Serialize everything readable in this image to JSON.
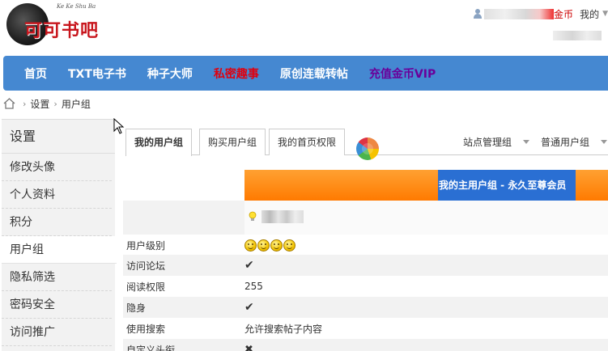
{
  "header": {
    "logo_text": "可可书吧",
    "logo_subtext": "Ke Ke Shu Ba",
    "coin_label": "金币",
    "my_label": "我的"
  },
  "nav": {
    "items": [
      {
        "label": "首页",
        "style": "normal"
      },
      {
        "label": "TXT电子书",
        "style": "normal"
      },
      {
        "label": "种子大师",
        "style": "normal"
      },
      {
        "label": "私密趣事",
        "style": "red"
      },
      {
        "label": "原创连载转帖",
        "style": "normal"
      },
      {
        "label": "充值金币VIP",
        "style": "purple"
      }
    ]
  },
  "breadcrumb": {
    "items": [
      "设置",
      "用户组"
    ]
  },
  "sidebar": {
    "title": "设置",
    "items": [
      {
        "label": "修改头像"
      },
      {
        "label": "个人资料"
      },
      {
        "label": "积分"
      },
      {
        "label": "用户组",
        "active": true
      },
      {
        "label": "隐私筛选"
      },
      {
        "label": "密码安全"
      },
      {
        "label": "访问推广"
      }
    ]
  },
  "tabs": {
    "items": [
      "我的用户组",
      "购买用户组",
      "我的首页权限"
    ],
    "right": [
      "站点管理组",
      "普通用户组"
    ]
  },
  "table": {
    "band_title": "我的主用户组 - 永久至尊会员",
    "rows": [
      {
        "label": "用户级别",
        "type": "smileys",
        "count": 4
      },
      {
        "label": "访问论坛",
        "type": "check"
      },
      {
        "label": "阅读权限",
        "type": "text",
        "value": "255"
      },
      {
        "label": "隐身",
        "type": "check"
      },
      {
        "label": "使用搜索",
        "type": "text",
        "value": "允许搜索帖子内容"
      },
      {
        "label": "自定义头衔",
        "type": "cross"
      }
    ]
  },
  "colors": {
    "nav_bg": "#4588d1",
    "accent_red": "#e0000e",
    "accent_purple": "#6a009a",
    "band_orange": "#ff8a10",
    "band_blue": "#2a6fd3"
  }
}
